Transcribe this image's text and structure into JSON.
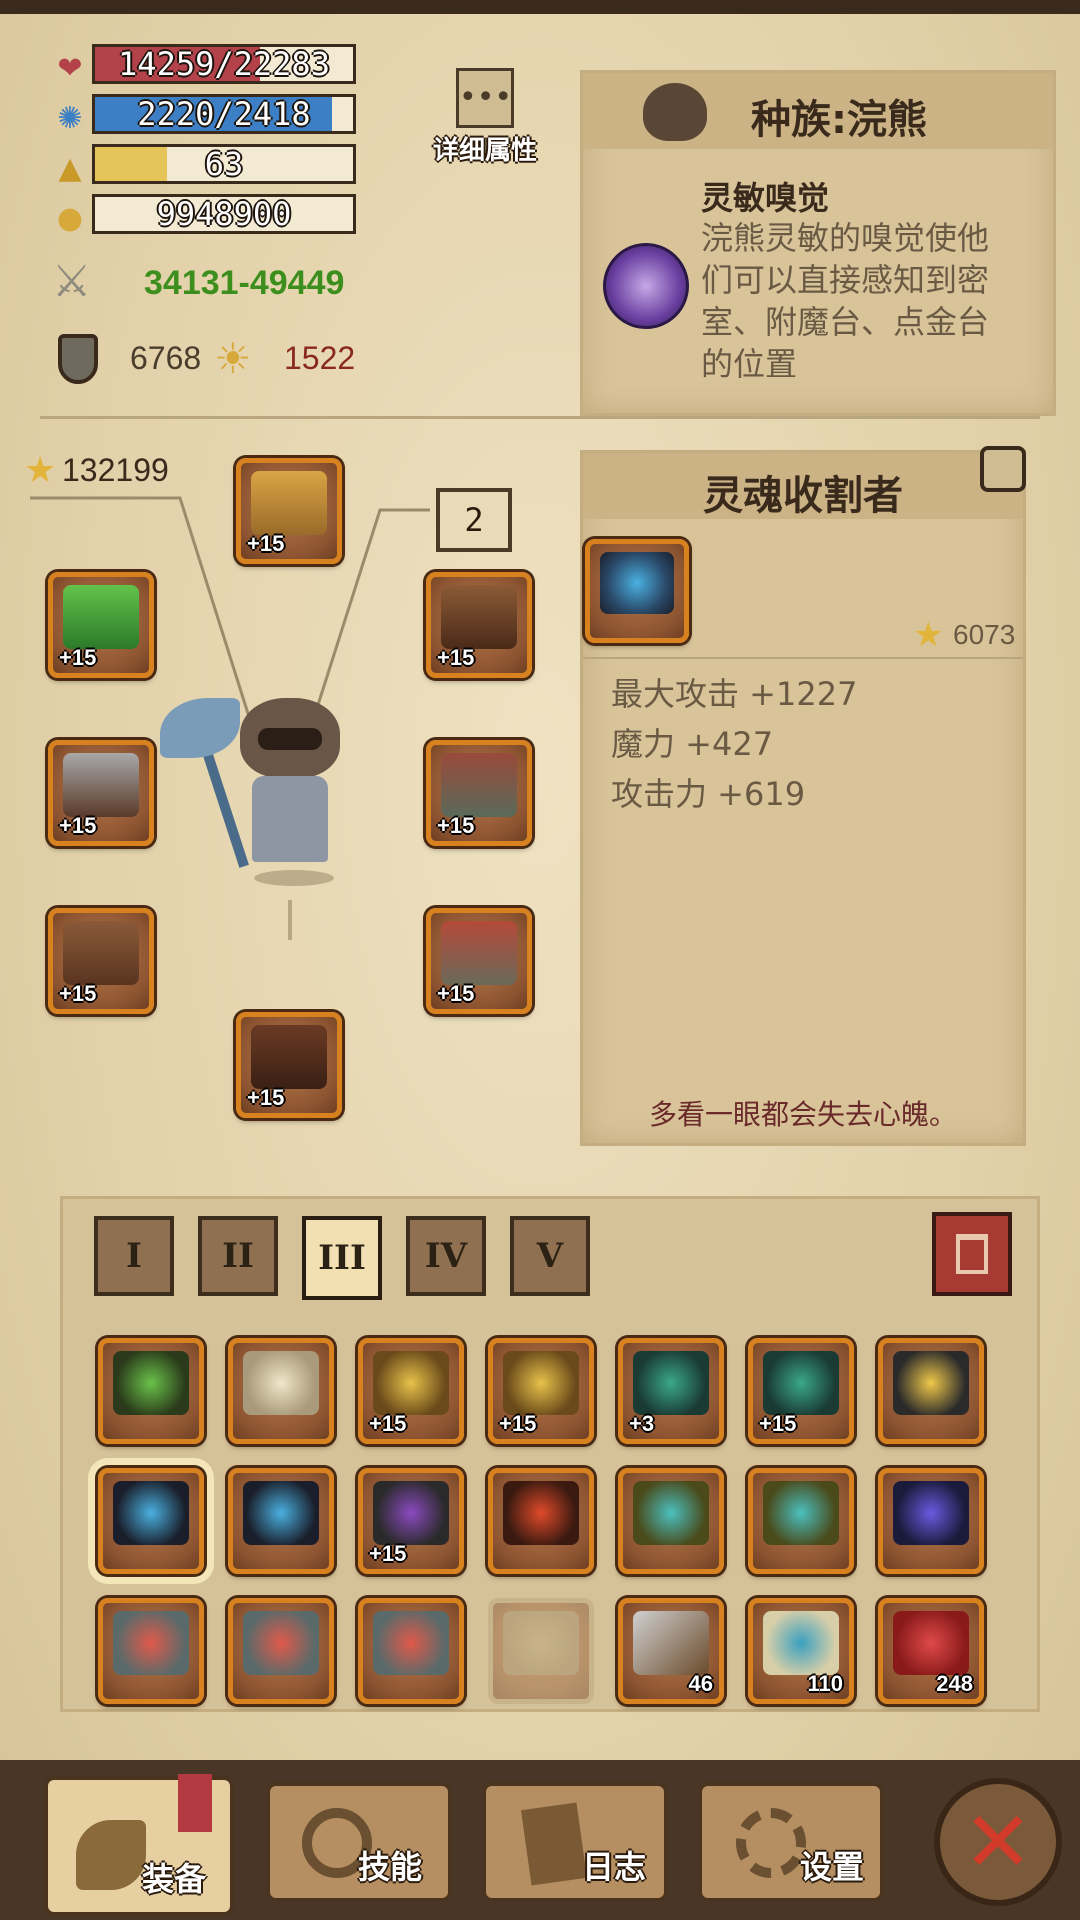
{
  "stats": {
    "hp": "14259/22283",
    "hp_fraction": 0.64,
    "mp": "2220/2418",
    "mp_fraction": 0.92,
    "level": "63",
    "xp_fraction": 0.28,
    "gold": "9948900",
    "attack_range": "34131-49449",
    "armor": "6768",
    "magic_resist": "1522",
    "icons": [
      "heart-icon",
      "mana-gear-icon",
      "triangle-level-icon",
      "gold-coins-icon",
      "crossed-swords-icon",
      "shield-icon",
      "magic-torch-icon"
    ]
  },
  "detail_button": {
    "label": "详细属性"
  },
  "race_panel": {
    "title": "种族:浣熊",
    "skill_name": "灵敏嗅觉",
    "skill_desc_lines": [
      "浣熊灵敏的嗅觉使他",
      "们可以直接感知到密",
      "室、附魔台、点金台",
      "的位置"
    ]
  },
  "equipment": {
    "score": "132199",
    "set_number": "2",
    "slots": [
      {
        "name": "helmet",
        "level": "+15"
      },
      {
        "name": "amulet",
        "level": "+15"
      },
      {
        "name": "shoulder",
        "level": "+15"
      },
      {
        "name": "weapon",
        "level": "+15"
      },
      {
        "name": "armor",
        "level": "+15"
      },
      {
        "name": "ring",
        "level": "+15"
      },
      {
        "name": "pants",
        "level": "+15"
      },
      {
        "name": "boots",
        "level": "+15"
      }
    ]
  },
  "item_panel": {
    "title": "灵魂收割者",
    "score": "6073",
    "stats": [
      "最大攻击 +1227",
      "魔力 +427",
      "攻击力 +619"
    ],
    "flavor": "多看一眼都会失去心魄。"
  },
  "inventory": {
    "tabs": [
      "I",
      "II",
      "III",
      "IV",
      "V"
    ],
    "active_tab": "III",
    "rows": [
      [
        {
          "item": "green-beetle-amulet",
          "label": ""
        },
        {
          "item": "winged-amulet",
          "label": ""
        },
        {
          "item": "dollar-amulet",
          "label": "+15"
        },
        {
          "item": "dollar-amulet",
          "label": "+15"
        },
        {
          "item": "jade-spiral-amulet",
          "label": "+3"
        },
        {
          "item": "jade-spiral-amulet",
          "label": "+15"
        },
        {
          "item": "gold-cross-amulet",
          "label": ""
        }
      ],
      [
        {
          "item": "soul-reaper-ring",
          "label": ""
        },
        {
          "item": "soul-reaper-ring",
          "label": ""
        },
        {
          "item": "spider-ring",
          "label": "+15"
        },
        {
          "item": "lava-ring",
          "label": ""
        },
        {
          "item": "vine-ring",
          "label": ""
        },
        {
          "item": "vine-ring",
          "label": ""
        },
        {
          "item": "galaxy-ring",
          "label": ""
        }
      ],
      [
        {
          "item": "striped-ring",
          "label": ""
        },
        {
          "item": "striped-ring",
          "label": ""
        },
        {
          "item": "striped-ring",
          "label": ""
        },
        {
          "item": "locked-slot",
          "label": ""
        },
        {
          "item": "pickaxe",
          "label": "46"
        },
        {
          "item": "map-scroll",
          "label": "110"
        },
        {
          "item": "red-potion",
          "label": "248"
        }
      ]
    ]
  },
  "nav": {
    "equip": "装备",
    "skills": "技能",
    "log": "日志",
    "settings": "设置"
  },
  "colors": {
    "hp": "#b3424a",
    "mp": "#3d7fc4",
    "xp": "#e5c45a",
    "slot_border": "#d8811f",
    "close_red": "#d23a2a"
  }
}
